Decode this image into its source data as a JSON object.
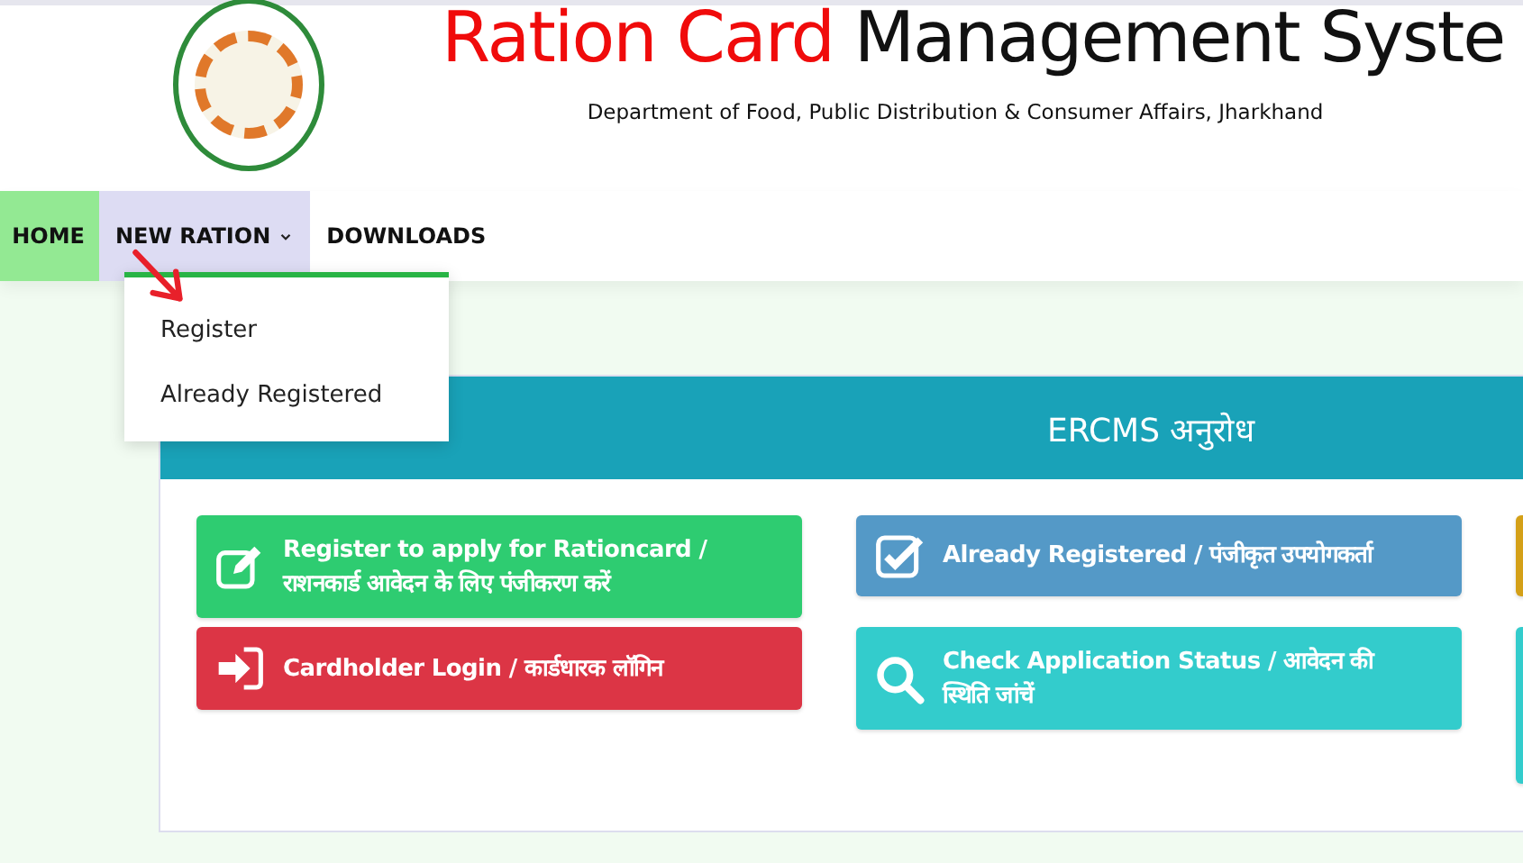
{
  "header": {
    "title_red": "Ration Card",
    "title_black": "Management Syste",
    "subtitle": "Department of Food, Public Distribution & Consumer Affairs, Jharkhand"
  },
  "nav": {
    "items": [
      {
        "label": "HOME",
        "current": true,
        "selected": false,
        "caret": false
      },
      {
        "label": "NEW RATION",
        "current": false,
        "selected": true,
        "caret": true,
        "expanded": true,
        "dropdown": [
          {
            "label": "Register"
          },
          {
            "label": "Already Registered"
          }
        ]
      },
      {
        "label": "DOWNLOADS",
        "current": false,
        "selected": false,
        "caret": false
      }
    ]
  },
  "panel": {
    "title": "ERCMS अनुरोध",
    "buttons": [
      {
        "kind": "edit",
        "color": "#2ecc71",
        "lines": [
          "Register to apply for Rationcard /",
          "राशनकार्ड आवेदन के लिए पंजीकरण करें"
        ]
      },
      {
        "kind": "check",
        "color": "#5499c7",
        "lines": [
          "Already Registered / पंजीकृत उपयोगकर्ता"
        ]
      },
      {
        "kind": "cut",
        "color": "#d4a017"
      },
      {
        "kind": "login",
        "color": "#dc3545",
        "lines": [
          "Cardholder Login / कार्डधारक लॉगिन"
        ]
      },
      {
        "kind": "search",
        "color": "#33cccc",
        "lines": [
          "Check Application Status / आवेदन की",
          "स्थिति जांचें"
        ]
      },
      {
        "kind": "cut",
        "color": "#33cccc"
      }
    ]
  }
}
